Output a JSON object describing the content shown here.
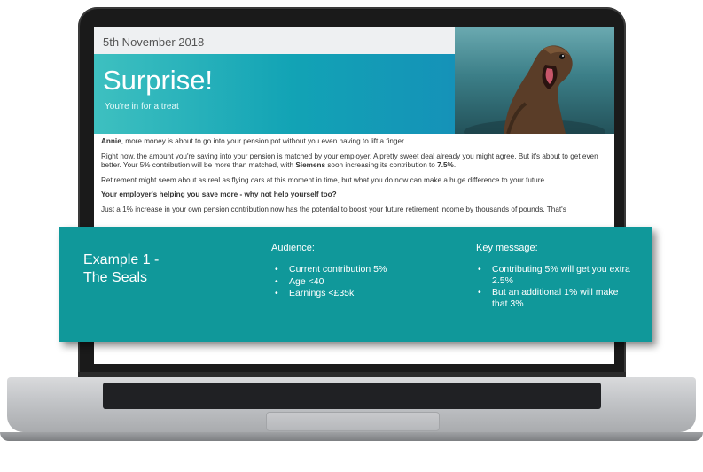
{
  "email": {
    "date": "5th November 2018",
    "title": "Surprise!",
    "subtitle": "You're in for a treat",
    "paragraphs": {
      "p1_name": "Annie",
      "p1_rest": ", more money is about to go into your pension pot without you even having to lift a finger.",
      "p2_start": "Right now, the amount you're saving into your pension is matched by your employer. A pretty sweet deal already you might agree. But it's about to get even better. Your 5% contribution will be more than matched, with ",
      "p2_company": "Siemens",
      "p2_mid": " soon increasing its contribution to ",
      "p2_rate": "7.5%",
      "p2_end": ".",
      "p3": "Retirement might seem about as real as flying cars at this moment in time, but what you do now can make a huge difference to your future.",
      "heading": "Your employer's helping you save more - why not help yourself too?",
      "p4": "Just a 1% increase in your own pension contribution now has the potential to boost your future retirement income by thousands of pounds. That's"
    }
  },
  "overlay": {
    "example_title": "Example 1 -\nThe Seals",
    "audience_title": "Audience:",
    "audience_items": [
      "Current contribution 5%",
      "Age <40",
      "Earnings <£35k"
    ],
    "key_message_title": "Key message:",
    "key_message_items": [
      "Contributing 5% will get you extra 2.5%",
      "But an additional 1% will make that 3%"
    ]
  },
  "colors": {
    "teal_overlay": "#10989a",
    "banner_teal": "#12a3b5",
    "laptop_bezel": "#1a1a1a"
  },
  "icons": {
    "photo": "sea-lion-photo"
  }
}
